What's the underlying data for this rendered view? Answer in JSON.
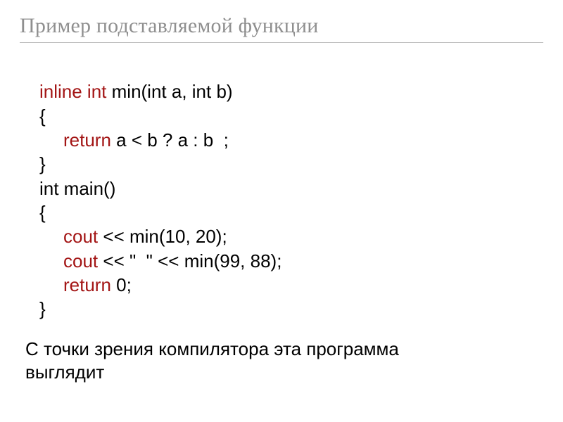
{
  "title": "Пример подставляемой функции",
  "code": {
    "l1": {
      "kw": "inline int",
      "rest": " min(int a, int b)"
    },
    "l2": "{",
    "l3_ret": "return",
    "l3_rest": " a < b ? a : b  ;",
    "l4": "}",
    "l5": "int main()",
    "l6": "{",
    "l7_out": "cout",
    "l7_rest": " << min(10, 20);",
    "l8_out": "cout",
    "l8_rest": " << \"  \" << min(99, 88);",
    "l9_ret": "return",
    "l9_rest": " 0;",
    "l10": "}"
  },
  "note_line1": "С точки зрения компилятора эта программа",
  "note_line2": "выглядит"
}
